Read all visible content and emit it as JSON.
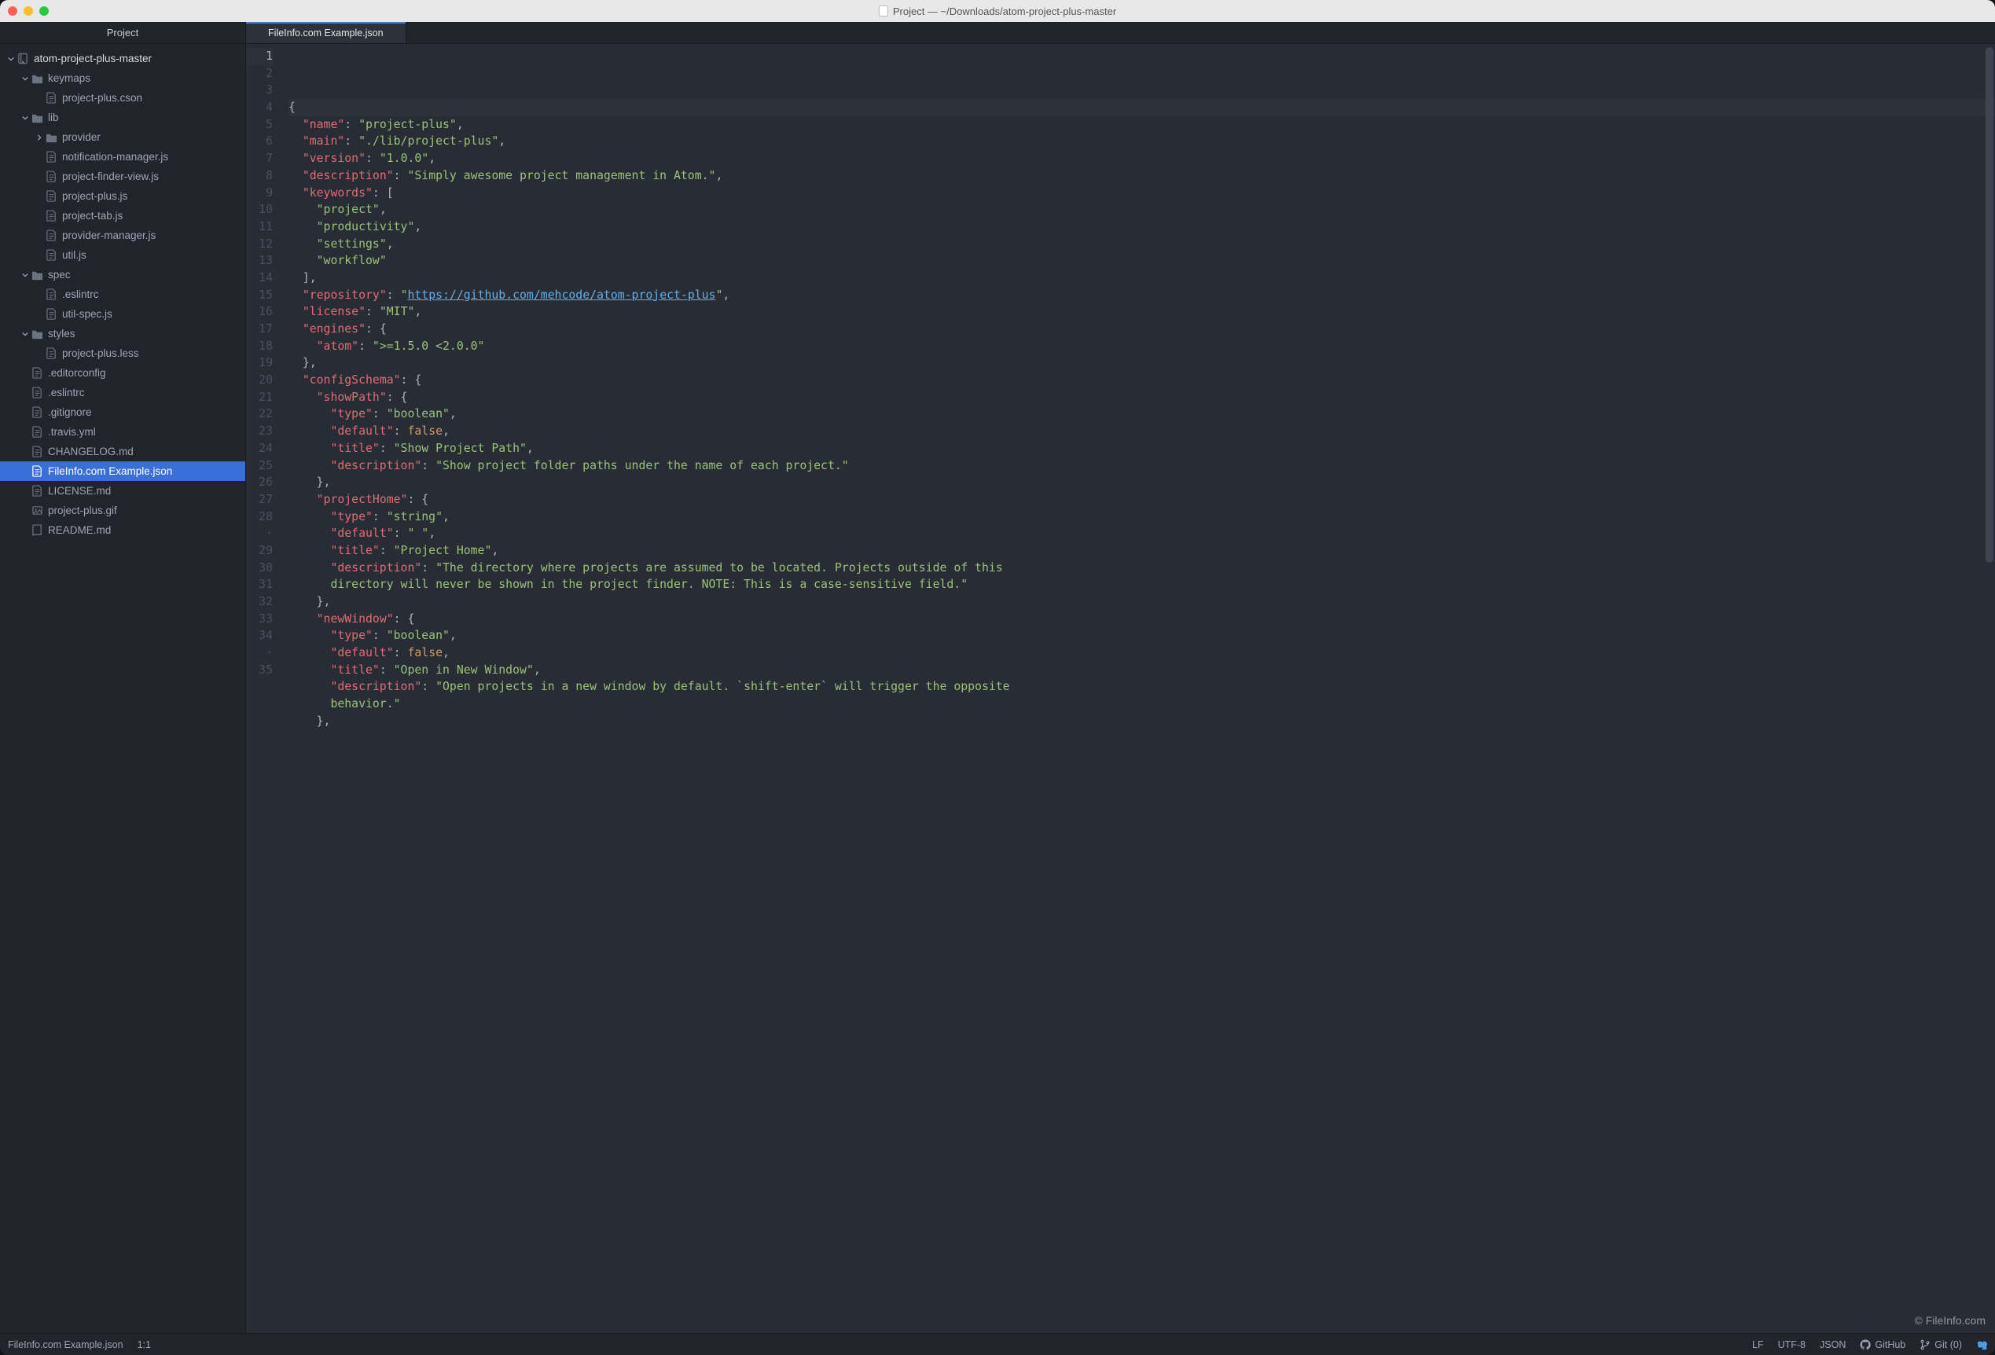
{
  "window": {
    "title": "Project — ~/Downloads/atom-project-plus-master"
  },
  "project_panel_title": "Project",
  "open_tab": "FileInfo.com Example.json",
  "tree": [
    {
      "label": "atom-project-plus-master",
      "depth": 0,
      "kind": "folder-repo",
      "disclosure": "down",
      "root": true
    },
    {
      "label": "keymaps",
      "depth": 1,
      "kind": "folder",
      "disclosure": "down"
    },
    {
      "label": "project-plus.cson",
      "depth": 2,
      "kind": "file"
    },
    {
      "label": "lib",
      "depth": 1,
      "kind": "folder",
      "disclosure": "down"
    },
    {
      "label": "provider",
      "depth": 2,
      "kind": "folder",
      "disclosure": "right"
    },
    {
      "label": "notification-manager.js",
      "depth": 2,
      "kind": "file"
    },
    {
      "label": "project-finder-view.js",
      "depth": 2,
      "kind": "file"
    },
    {
      "label": "project-plus.js",
      "depth": 2,
      "kind": "file"
    },
    {
      "label": "project-tab.js",
      "depth": 2,
      "kind": "file"
    },
    {
      "label": "provider-manager.js",
      "depth": 2,
      "kind": "file"
    },
    {
      "label": "util.js",
      "depth": 2,
      "kind": "file"
    },
    {
      "label": "spec",
      "depth": 1,
      "kind": "folder",
      "disclosure": "down"
    },
    {
      "label": ".eslintrc",
      "depth": 2,
      "kind": "file"
    },
    {
      "label": "util-spec.js",
      "depth": 2,
      "kind": "file"
    },
    {
      "label": "styles",
      "depth": 1,
      "kind": "folder",
      "disclosure": "down"
    },
    {
      "label": "project-plus.less",
      "depth": 2,
      "kind": "file"
    },
    {
      "label": ".editorconfig",
      "depth": 1,
      "kind": "file"
    },
    {
      "label": ".eslintrc",
      "depth": 1,
      "kind": "file"
    },
    {
      "label": ".gitignore",
      "depth": 1,
      "kind": "file"
    },
    {
      "label": ".travis.yml",
      "depth": 1,
      "kind": "file"
    },
    {
      "label": "CHANGELOG.md",
      "depth": 1,
      "kind": "file"
    },
    {
      "label": "FileInfo.com Example.json",
      "depth": 1,
      "kind": "file",
      "selected": true
    },
    {
      "label": "LICENSE.md",
      "depth": 1,
      "kind": "file"
    },
    {
      "label": "project-plus.gif",
      "depth": 1,
      "kind": "image"
    },
    {
      "label": "README.md",
      "depth": 1,
      "kind": "book"
    }
  ],
  "editor": {
    "active_line": 1,
    "lines": [
      {
        "n": "1",
        "tokens": [
          [
            "punc",
            "{"
          ]
        ]
      },
      {
        "n": "2",
        "tokens": [
          [
            "pad",
            "  "
          ],
          [
            "key",
            "\"name\""
          ],
          [
            "punc",
            ": "
          ],
          [
            "str",
            "\"project-plus\""
          ],
          [
            "punc",
            ","
          ]
        ]
      },
      {
        "n": "3",
        "tokens": [
          [
            "pad",
            "  "
          ],
          [
            "key",
            "\"main\""
          ],
          [
            "punc",
            ": "
          ],
          [
            "str",
            "\"./lib/project-plus\""
          ],
          [
            "punc",
            ","
          ]
        ]
      },
      {
        "n": "4",
        "tokens": [
          [
            "pad",
            "  "
          ],
          [
            "key",
            "\"version\""
          ],
          [
            "punc",
            ": "
          ],
          [
            "str",
            "\"1.0.0\""
          ],
          [
            "punc",
            ","
          ]
        ]
      },
      {
        "n": "5",
        "tokens": [
          [
            "pad",
            "  "
          ],
          [
            "key",
            "\"description\""
          ],
          [
            "punc",
            ": "
          ],
          [
            "str",
            "\"Simply awesome project management in Atom.\""
          ],
          [
            "punc",
            ","
          ]
        ]
      },
      {
        "n": "6",
        "tokens": [
          [
            "pad",
            "  "
          ],
          [
            "key",
            "\"keywords\""
          ],
          [
            "punc",
            ": ["
          ]
        ]
      },
      {
        "n": "7",
        "tokens": [
          [
            "pad",
            "    "
          ],
          [
            "str",
            "\"project\""
          ],
          [
            "punc",
            ","
          ]
        ]
      },
      {
        "n": "8",
        "tokens": [
          [
            "pad",
            "    "
          ],
          [
            "str",
            "\"productivity\""
          ],
          [
            "punc",
            ","
          ]
        ]
      },
      {
        "n": "9",
        "tokens": [
          [
            "pad",
            "    "
          ],
          [
            "str",
            "\"settings\""
          ],
          [
            "punc",
            ","
          ]
        ]
      },
      {
        "n": "10",
        "tokens": [
          [
            "pad",
            "    "
          ],
          [
            "str",
            "\"workflow\""
          ]
        ]
      },
      {
        "n": "11",
        "tokens": [
          [
            "pad",
            "  "
          ],
          [
            "punc",
            "],"
          ]
        ]
      },
      {
        "n": "12",
        "tokens": [
          [
            "pad",
            "  "
          ],
          [
            "key",
            "\"repository\""
          ],
          [
            "punc",
            ": "
          ],
          [
            "str",
            "\""
          ],
          [
            "url",
            "https://github.com/mehcode/atom-project-plus"
          ],
          [
            "str",
            "\""
          ],
          [
            "punc",
            ","
          ]
        ]
      },
      {
        "n": "13",
        "tokens": [
          [
            "pad",
            "  "
          ],
          [
            "key",
            "\"license\""
          ],
          [
            "punc",
            ": "
          ],
          [
            "str",
            "\"MIT\""
          ],
          [
            "punc",
            ","
          ]
        ]
      },
      {
        "n": "14",
        "tokens": [
          [
            "pad",
            "  "
          ],
          [
            "key",
            "\"engines\""
          ],
          [
            "punc",
            ": {"
          ]
        ]
      },
      {
        "n": "15",
        "tokens": [
          [
            "pad",
            "    "
          ],
          [
            "key",
            "\"atom\""
          ],
          [
            "punc",
            ": "
          ],
          [
            "str",
            "\">=1.5.0 <2.0.0\""
          ]
        ]
      },
      {
        "n": "16",
        "tokens": [
          [
            "pad",
            "  "
          ],
          [
            "punc",
            "},"
          ]
        ]
      },
      {
        "n": "17",
        "tokens": [
          [
            "pad",
            "  "
          ],
          [
            "key",
            "\"configSchema\""
          ],
          [
            "punc",
            ": {"
          ]
        ]
      },
      {
        "n": "18",
        "tokens": [
          [
            "pad",
            "    "
          ],
          [
            "key",
            "\"showPath\""
          ],
          [
            "punc",
            ": {"
          ]
        ]
      },
      {
        "n": "19",
        "tokens": [
          [
            "pad",
            "      "
          ],
          [
            "key",
            "\"type\""
          ],
          [
            "punc",
            ": "
          ],
          [
            "str",
            "\"boolean\""
          ],
          [
            "punc",
            ","
          ]
        ]
      },
      {
        "n": "20",
        "tokens": [
          [
            "pad",
            "      "
          ],
          [
            "key",
            "\"default\""
          ],
          [
            "punc",
            ": "
          ],
          [
            "bool",
            "false"
          ],
          [
            "punc",
            ","
          ]
        ]
      },
      {
        "n": "21",
        "tokens": [
          [
            "pad",
            "      "
          ],
          [
            "key",
            "\"title\""
          ],
          [
            "punc",
            ": "
          ],
          [
            "str",
            "\"Show Project Path\""
          ],
          [
            "punc",
            ","
          ]
        ]
      },
      {
        "n": "22",
        "tokens": [
          [
            "pad",
            "      "
          ],
          [
            "key",
            "\"description\""
          ],
          [
            "punc",
            ": "
          ],
          [
            "str",
            "\"Show project folder paths under the name of each project.\""
          ]
        ]
      },
      {
        "n": "23",
        "tokens": [
          [
            "pad",
            "    "
          ],
          [
            "punc",
            "},"
          ]
        ]
      },
      {
        "n": "24",
        "tokens": [
          [
            "pad",
            "    "
          ],
          [
            "key",
            "\"projectHome\""
          ],
          [
            "punc",
            ": {"
          ]
        ]
      },
      {
        "n": "25",
        "tokens": [
          [
            "pad",
            "      "
          ],
          [
            "key",
            "\"type\""
          ],
          [
            "punc",
            ": "
          ],
          [
            "str",
            "\"string\""
          ],
          [
            "punc",
            ","
          ]
        ]
      },
      {
        "n": "26",
        "tokens": [
          [
            "pad",
            "      "
          ],
          [
            "key",
            "\"default\""
          ],
          [
            "punc",
            ": "
          ],
          [
            "str",
            "\" \""
          ],
          [
            "punc",
            ","
          ]
        ]
      },
      {
        "n": "27",
        "tokens": [
          [
            "pad",
            "      "
          ],
          [
            "key",
            "\"title\""
          ],
          [
            "punc",
            ": "
          ],
          [
            "str",
            "\"Project Home\""
          ],
          [
            "punc",
            ","
          ]
        ]
      },
      {
        "n": "28",
        "tokens": [
          [
            "pad",
            "      "
          ],
          [
            "key",
            "\"description\""
          ],
          [
            "punc",
            ": "
          ],
          [
            "str",
            "\"The directory where projects are assumed to be located. Projects outside of this "
          ]
        ]
      },
      {
        "n": "·",
        "tokens": [
          [
            "pad",
            "      "
          ],
          [
            "str",
            "directory will never be shown in the project finder. NOTE: This is a case-sensitive field.\""
          ]
        ]
      },
      {
        "n": "29",
        "tokens": [
          [
            "pad",
            "    "
          ],
          [
            "punc",
            "},"
          ]
        ]
      },
      {
        "n": "30",
        "tokens": [
          [
            "pad",
            "    "
          ],
          [
            "key",
            "\"newWindow\""
          ],
          [
            "punc",
            ": {"
          ]
        ]
      },
      {
        "n": "31",
        "tokens": [
          [
            "pad",
            "      "
          ],
          [
            "key",
            "\"type\""
          ],
          [
            "punc",
            ": "
          ],
          [
            "str",
            "\"boolean\""
          ],
          [
            "punc",
            ","
          ]
        ]
      },
      {
        "n": "32",
        "tokens": [
          [
            "pad",
            "      "
          ],
          [
            "key",
            "\"default\""
          ],
          [
            "punc",
            ": "
          ],
          [
            "bool",
            "false"
          ],
          [
            "punc",
            ","
          ]
        ]
      },
      {
        "n": "33",
        "tokens": [
          [
            "pad",
            "      "
          ],
          [
            "key",
            "\"title\""
          ],
          [
            "punc",
            ": "
          ],
          [
            "str",
            "\"Open in New Window\""
          ],
          [
            "punc",
            ","
          ]
        ]
      },
      {
        "n": "34",
        "tokens": [
          [
            "pad",
            "      "
          ],
          [
            "key",
            "\"description\""
          ],
          [
            "punc",
            ": "
          ],
          [
            "str",
            "\"Open projects in a new window by default. `shift-enter` will trigger the opposite "
          ]
        ]
      },
      {
        "n": "·",
        "tokens": [
          [
            "pad",
            "      "
          ],
          [
            "str",
            "behavior.\""
          ]
        ]
      },
      {
        "n": "35",
        "tokens": [
          [
            "pad",
            "    "
          ],
          [
            "punc",
            "},"
          ]
        ]
      }
    ]
  },
  "watermark": "© FileInfo.com",
  "status": {
    "file": "FileInfo.com Example.json",
    "cursor": "1:1",
    "eol": "LF",
    "encoding": "UTF-8",
    "grammar": "JSON",
    "github": "GitHub",
    "git": "Git (0)"
  }
}
